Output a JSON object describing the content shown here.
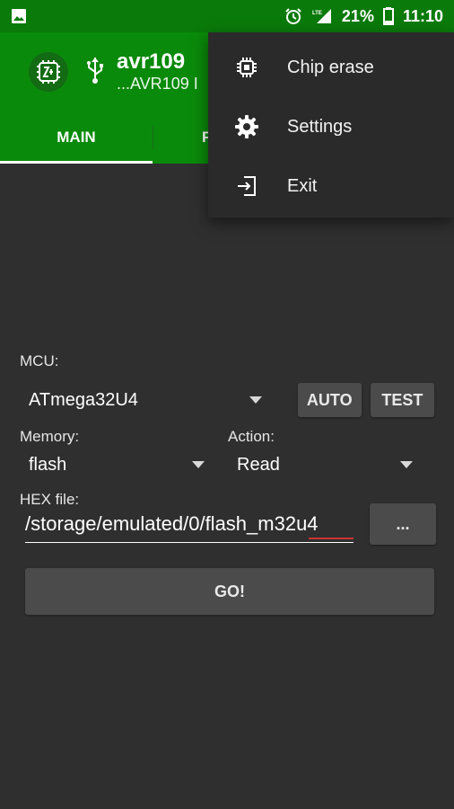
{
  "status_bar": {
    "battery": "21%",
    "time": "11:10"
  },
  "app": {
    "title": "avr109",
    "subtitle": "...AVR109 I"
  },
  "tabs": [
    {
      "label": "MAIN"
    },
    {
      "label": "F"
    }
  ],
  "menu": {
    "items": [
      {
        "label": "Chip erase",
        "icon": "chip-icon"
      },
      {
        "label": "Settings",
        "icon": "gear-icon"
      },
      {
        "label": "Exit",
        "icon": "exit-icon"
      }
    ]
  },
  "form": {
    "mcu_label": "MCU:",
    "mcu_value": "ATmega32U4",
    "auto_button": "AUTO",
    "test_button": "TEST",
    "memory_label": "Memory:",
    "memory_value": "flash",
    "action_label": "Action:",
    "action_value": "Read",
    "hex_label": "HEX file:",
    "hex_value": "/storage/emulated/0/flash_m32u4",
    "browse_button": "...",
    "go_button": "GO!"
  }
}
